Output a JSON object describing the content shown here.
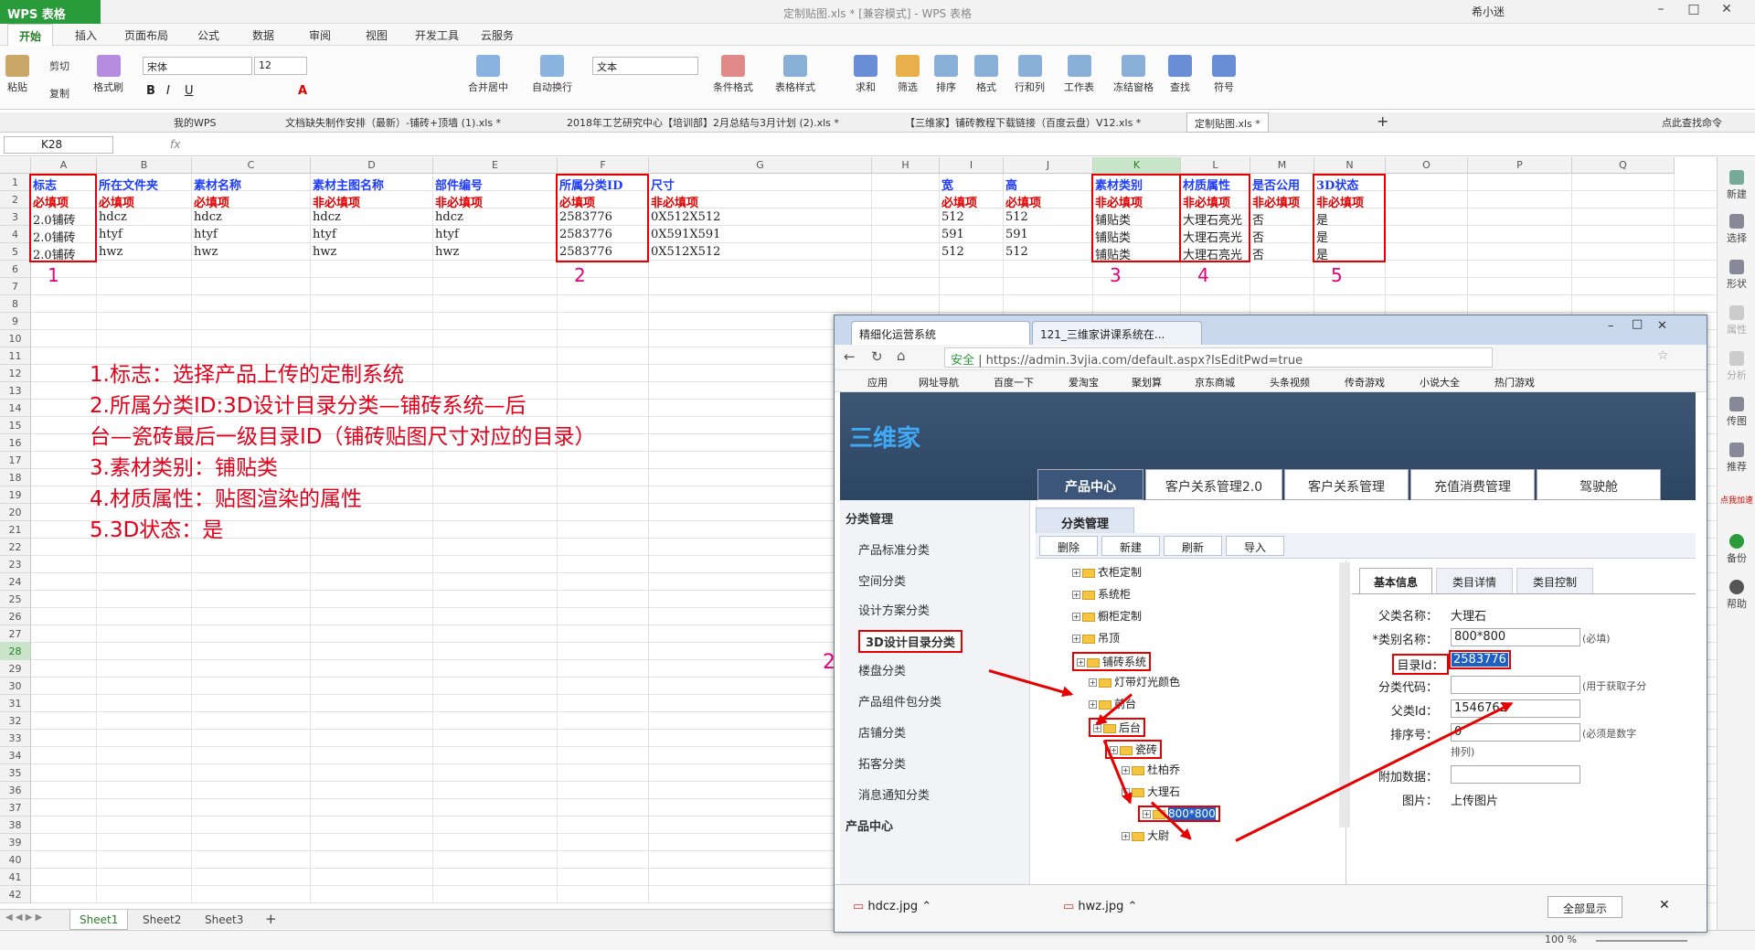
{
  "app": {
    "logo": "WPS 表格",
    "title": "定制贴图.xls * [兼容模式] - WPS 表格",
    "user": "希小迷"
  },
  "menu": [
    "开始",
    "插入",
    "页面布局",
    "公式",
    "数据",
    "审阅",
    "视图",
    "开发工具",
    "云服务"
  ],
  "ribbon": {
    "paste": "粘贴",
    "cut": "剪切",
    "copy": "复制",
    "format_painter": "格式刷",
    "font": "宋体",
    "size": "12",
    "merge": "合并居中",
    "wrap": "自动换行",
    "numfmt": "文本",
    "cond": "条件格式",
    "tblstyle": "表格样式",
    "sum": "求和",
    "filter": "筛选",
    "sort": "排序",
    "format": "格式",
    "rowcol": "行和列",
    "sheet": "工作表",
    "freeze": "冻结窗格",
    "find": "查找",
    "symbol": "符号"
  },
  "doc_tabs": [
    "我的WPS",
    "文档缺失制作安排（最新）-铺砖+顶墙 (1).xls *",
    "2018年工艺研究中心【培训部】2月总结与3月计划 (2).xls *",
    "【三维家】铺砖教程下载链接（百度云盘）V12.xls *",
    "定制贴图.xls *"
  ],
  "find_cmd": "点此查找命令",
  "namebox": "K28",
  "fx": "fx",
  "columns": [
    "A",
    "B",
    "C",
    "D",
    "E",
    "F",
    "G",
    "H",
    "I",
    "J",
    "K",
    "L",
    "M",
    "N",
    "O",
    "P",
    "Q"
  ],
  "header_row1": [
    "标志",
    "所在文件夹",
    "素材名称",
    "素材主图名称",
    "部件编号",
    "所属分类ID",
    "尺寸",
    "",
    "宽",
    "高",
    "素材类别",
    "材质属性",
    "是否公用",
    "3D状态"
  ],
  "header_row2": [
    "必填项",
    "必填项",
    "必填项",
    "非必填项",
    "非必填项",
    "必填项",
    "非必填项",
    "",
    "必填项",
    "必填项",
    "非必填项",
    "非必填项",
    "非必填项",
    "非必填项"
  ],
  "rows": [
    [
      "2.0铺砖",
      "hdcz",
      "hdcz",
      "hdcz",
      "hdcz",
      "2583776",
      "0X512X512",
      "",
      "512",
      "512",
      "铺贴类",
      "大理石亮光",
      "否",
      "是"
    ],
    [
      "2.0铺砖",
      "htyf",
      "htyf",
      "htyf",
      "htyf",
      "2583776",
      "0X591X591",
      "",
      "591",
      "591",
      "铺贴类",
      "大理石亮光",
      "否",
      "是"
    ],
    [
      "2.0铺砖",
      "hwz",
      "hwz",
      "hwz",
      "hwz",
      "2583776",
      "0X512X512",
      "",
      "512",
      "512",
      "铺贴类",
      "大理石亮光",
      "否",
      "是"
    ]
  ],
  "marks": [
    "1",
    "2",
    "3",
    "4",
    "5"
  ],
  "notes": [
    "1.标志：选择产品上传的定制系统",
    "2.所属分类ID:3D设计目录分类—铺砖系统—后",
    "台—瓷砖最后一级目录ID（铺砖贴图尺寸对应的目录）",
    "3.素材类别：铺贴类",
    "4.材质属性：贴图渲染的属性",
    "5.3D状态：是"
  ],
  "sheets": [
    "Sheet1",
    "Sheet2",
    "Sheet3"
  ],
  "zoom": "100 %",
  "right_panel": [
    "新建",
    "选择",
    "形状",
    "属性",
    "分析",
    "传图",
    "推荐",
    "点我加速",
    "备份",
    "帮助"
  ],
  "browser": {
    "tabs": [
      "精细化运营系统",
      "121_三维家讲课系统在..."
    ],
    "secure": "安全",
    "url": "https://admin.3vjia.com/default.aspx?IsEditPwd=true",
    "bookmarks": [
      "应用",
      "网址导航",
      "百度一下",
      "爱淘宝",
      "聚划算",
      "京东商城",
      "头条视频",
      "传奇游戏",
      "小说大全",
      "热门游戏"
    ],
    "logo": "三维家",
    "nav": [
      "产品中心",
      "客户关系管理2.0",
      "客户关系管理",
      "充值消费管理",
      "驾驶舱"
    ],
    "left_nav": [
      "分类管理",
      "产品标准分类",
      "空间分类",
      "设计方案分类",
      "3D设计目录分类",
      "楼盘分类",
      "产品组件包分类",
      "店铺分类",
      "拓客分类",
      "消息通知分类",
      "产品中心"
    ],
    "panel_title": "分类管理",
    "toolbar": [
      "删除",
      "新建",
      "刷新",
      "导入"
    ],
    "tree": [
      "衣柜定制",
      "系统柜",
      "橱柜定制",
      "吊顶",
      "铺砖系统",
      "灯带灯光颜色",
      "前台",
      "后台",
      "瓷砖",
      "杜柏乔",
      "大理石",
      "800*800",
      "大尉"
    ],
    "detail_tabs": [
      "基本信息",
      "类目详情",
      "类目控制"
    ],
    "form": {
      "parent_name_label": "父类名称：",
      "parent_name": "大理石",
      "cat_name_label": "*类别名称：",
      "cat_name": "800*800",
      "required": "(必填)",
      "dir_id_label": "目录Id：",
      "dir_id": "2583776",
      "code_label": "分类代码：",
      "code_hint": "(用于获取子分",
      "parent_id_label": "父类Id：",
      "parent_id": "1546762",
      "order_label": "排序号：",
      "order": "0",
      "order_hint": "(必须是数字",
      "order_sub": "排列)",
      "extra_label": "附加数据：",
      "img_label": "图片：",
      "upload": "上传图片"
    },
    "downloads": [
      "hdcz.jpg",
      "hwz.jpg"
    ],
    "show_all": "全部显示",
    "arrow_mark": "2"
  }
}
